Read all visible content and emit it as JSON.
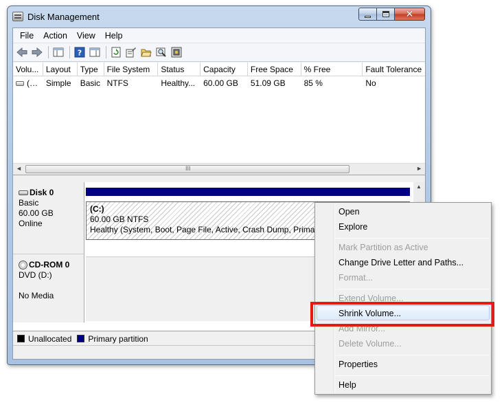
{
  "window": {
    "title": "Disk Management",
    "close_glyph": "✕"
  },
  "menubar": [
    "File",
    "Action",
    "View",
    "Help"
  ],
  "toolbar": {
    "buttons": [
      "back-icon",
      "forward-icon",
      "console-tree-icon",
      "help-icon",
      "action-pane-icon",
      "refresh-icon",
      "properties-icon",
      "open-folder-icon",
      "search-icon",
      "wizard-icon"
    ]
  },
  "volume_list": {
    "columns": [
      "Volu...",
      "Layout",
      "Type",
      "File System",
      "Status",
      "Capacity",
      "Free Space",
      "% Free",
      "Fault Tolerance"
    ],
    "rows": [
      {
        "volume": "(C:)",
        "layout": "Simple",
        "type": "Basic",
        "fs": "NTFS",
        "status": "Healthy...",
        "capacity": "60.00 GB",
        "free": "51.09 GB",
        "pct_free": "85 %",
        "fault": "No"
      }
    ],
    "scroll_grip": "III"
  },
  "disks": {
    "disk0": {
      "name": "Disk 0",
      "type": "Basic",
      "size": "60.00 GB",
      "state": "Online"
    },
    "partition": {
      "name": "(C:)",
      "size_fs": "60.00 GB NTFS",
      "status": "Healthy (System, Boot, Page File, Active, Crash Dump, Primary"
    },
    "cdrom0": {
      "name": "CD-ROM 0",
      "drive": "DVD (D:)",
      "media": "No Media"
    }
  },
  "legend": {
    "unallocated": "Unallocated",
    "primary": "Primary partition",
    "colors": {
      "unallocated": "#000000",
      "primary": "#000080"
    }
  },
  "context_menu": {
    "items": [
      {
        "label": "Open",
        "enabled": true
      },
      {
        "label": "Explore",
        "enabled": true
      },
      {
        "label": "Mark Partition as Active",
        "enabled": false
      },
      {
        "label": "Change Drive Letter and Paths...",
        "enabled": true
      },
      {
        "label": "Format...",
        "enabled": false
      },
      {
        "label": "Extend Volume...",
        "enabled": false
      },
      {
        "label": "Shrink Volume...",
        "enabled": true,
        "highlighted": true
      },
      {
        "label": "Add Mirror...",
        "enabled": false
      },
      {
        "label": "Delete Volume...",
        "enabled": false
      },
      {
        "label": "Properties",
        "enabled": true
      },
      {
        "label": "Help",
        "enabled": true
      }
    ]
  },
  "colors": {
    "callout": "#e31b12",
    "partition_bar": "#000080"
  }
}
